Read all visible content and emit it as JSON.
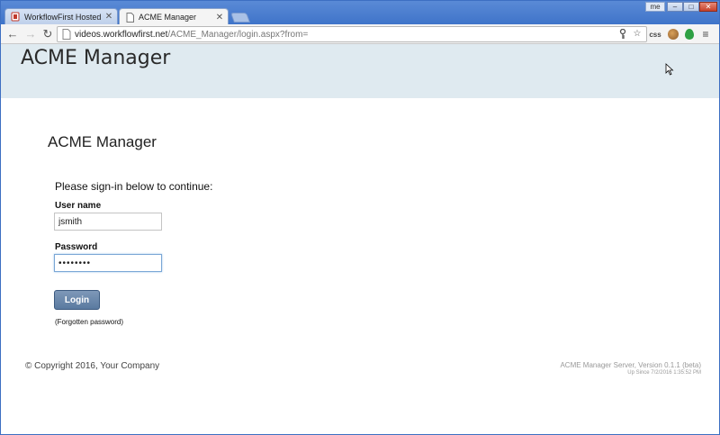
{
  "browser": {
    "tabs": [
      {
        "title": "WorkflowFirst Hosted De",
        "active": false
      },
      {
        "title": "ACME Manager",
        "active": true
      }
    ],
    "window_user": "me",
    "url": {
      "host": "videos.workflowfirst.net",
      "path": "/ACME_Manager/login.aspx?from="
    },
    "extensions": {
      "css_label": "css"
    },
    "colors": {
      "titlebar": "#4a7fd0",
      "toolbar": "#f4f4f4"
    }
  },
  "header": {
    "site_title": "ACME Manager",
    "background": "#dfeaf0"
  },
  "login": {
    "heading": "ACME Manager",
    "prompt": "Please sign-in below to continue:",
    "username_label": "User name",
    "username_value": "jsmith",
    "password_label": "Password",
    "password_value": "password",
    "button_label": "Login",
    "forgot_label": "(Forgotten password)",
    "button_color": "#6884a8"
  },
  "footer": {
    "copyright": "© Copyright 2016, Your Company",
    "version": "ACME Manager Server, Version 0.1.1 (beta)",
    "uptime": "Up Since 7/2/2016 1:35:52 PM"
  }
}
